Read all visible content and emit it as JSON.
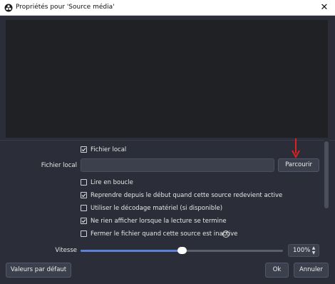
{
  "window": {
    "title": "Propriétés pour 'Source média'",
    "close_glyph": "✕"
  },
  "options": {
    "local_file_checkbox": {
      "label": "Fichier local",
      "checked": true
    },
    "local_file_field": {
      "label": "Fichier local",
      "value": "",
      "browse_label": "Parcourir"
    },
    "loop": {
      "label": "Lire en boucle",
      "checked": false
    },
    "restart": {
      "label": "Reprendre depuis le début quand cette source redevient active",
      "checked": true
    },
    "hw_decode": {
      "label": "Utiliser le décodage matériel (si disponible)",
      "checked": false
    },
    "hide_on_end": {
      "label": "Ne rien afficher lorsque la lecture se termine",
      "checked": true
    },
    "close_inactive": {
      "label": "Fermer le fichier quand cette source est inactive",
      "checked": false,
      "help_glyph": "?"
    },
    "speed": {
      "label": "Vitesse",
      "value_text": "100%",
      "value_fraction": 0.5,
      "up_glyph": "▲",
      "down_glyph": "▼"
    }
  },
  "footer": {
    "defaults_label": "Valeurs par défaut",
    "ok_label": "Ok",
    "cancel_label": "Annuler"
  },
  "colors": {
    "background": "#2b2e38",
    "preview": "#202125",
    "accent": "#5b82d6",
    "annotation_arrow": "#e02020"
  },
  "icons": [
    "obs-app-icon",
    "close-icon",
    "check-icon",
    "help-icon",
    "spin-up-icon",
    "spin-down-icon",
    "red-arrow-annotation"
  ]
}
